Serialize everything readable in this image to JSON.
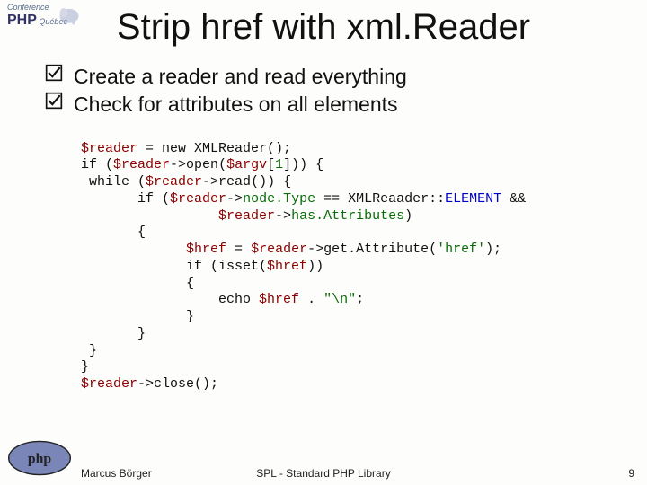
{
  "conf": {
    "line1": "Conférence",
    "line2": "PHP",
    "line3": "Québec"
  },
  "title": "Strip href with xml.Reader",
  "bullets": [
    "Create a reader and read everything",
    "Check for attributes on all elements"
  ],
  "code": {
    "l1a": "$reader ",
    "l1b": "= new ",
    "l1c": "XMLReader",
    "l1d": "();",
    "l2a": "if (",
    "l2b": "$reader",
    "l2c": "->",
    "l2d": "open",
    "l2e": "(",
    "l2f": "$argv",
    "l2g": "[",
    "l2h": "1",
    "l2i": "])) {",
    "l3a": " while (",
    "l3b": "$reader",
    "l3c": "->",
    "l3d": "read",
    "l3e": "()) {",
    "l4a": "       if (",
    "l4b": "$reader",
    "l4c": "->",
    "l4d": "node.Type ",
    "l4e": "== ",
    "l4f": "XMLReaader",
    "l4g": "::",
    "l4h": "ELEMENT ",
    "l4i": "&&",
    "l5a": "                 ",
    "l5b": "$reader",
    "l5c": "->",
    "l5d": "has.Attributes",
    "l5e": ")",
    "l6": "       {",
    "l7a": "             ",
    "l7b": "$href ",
    "l7c": "= ",
    "l7d": "$reader",
    "l7e": "->",
    "l7f": "get.Attribute",
    "l7g": "(",
    "l7h": "'href'",
    "l7i": ");",
    "l8a": "             if (isset(",
    "l8b": "$href",
    "l8c": "))",
    "l9": "             {",
    "l10a": "                 echo ",
    "l10b": "$href ",
    "l10c": ". ",
    "l10d": "\"\\n\"",
    "l10e": ";",
    "l11": "             }",
    "l12": "       }",
    "l13": " }",
    "l14": "}",
    "l15a": "$reader",
    "l15b": "->",
    "l15c": "close",
    "l15d": "();"
  },
  "footer": {
    "author": "Marcus Börger",
    "center": "SPL - Standard PHP Library",
    "page": "9"
  }
}
